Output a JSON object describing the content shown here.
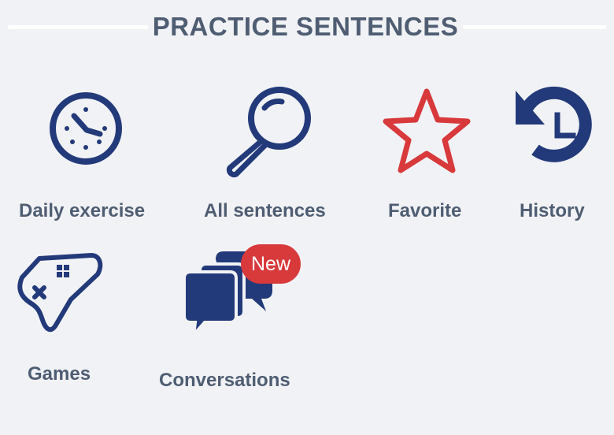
{
  "section": {
    "title": "PRACTICE SENTENCES"
  },
  "tiles": [
    {
      "label": "Daily exercise",
      "icon": "clock-icon"
    },
    {
      "label": "All sentences",
      "icon": "magnifier-icon"
    },
    {
      "label": "Favorite",
      "icon": "star-icon"
    },
    {
      "label": "History",
      "icon": "history-icon"
    },
    {
      "label": "Games",
      "icon": "gamepad-icon"
    },
    {
      "label": "Conversations",
      "icon": "chat-bubbles-icon",
      "badge": "New"
    }
  ],
  "colors": {
    "icon_primary": "#233a7a",
    "favorite_star": "#d8393b",
    "badge": "#d8393b",
    "label_text": "#4f5d73",
    "background": "#f1f2f5"
  }
}
